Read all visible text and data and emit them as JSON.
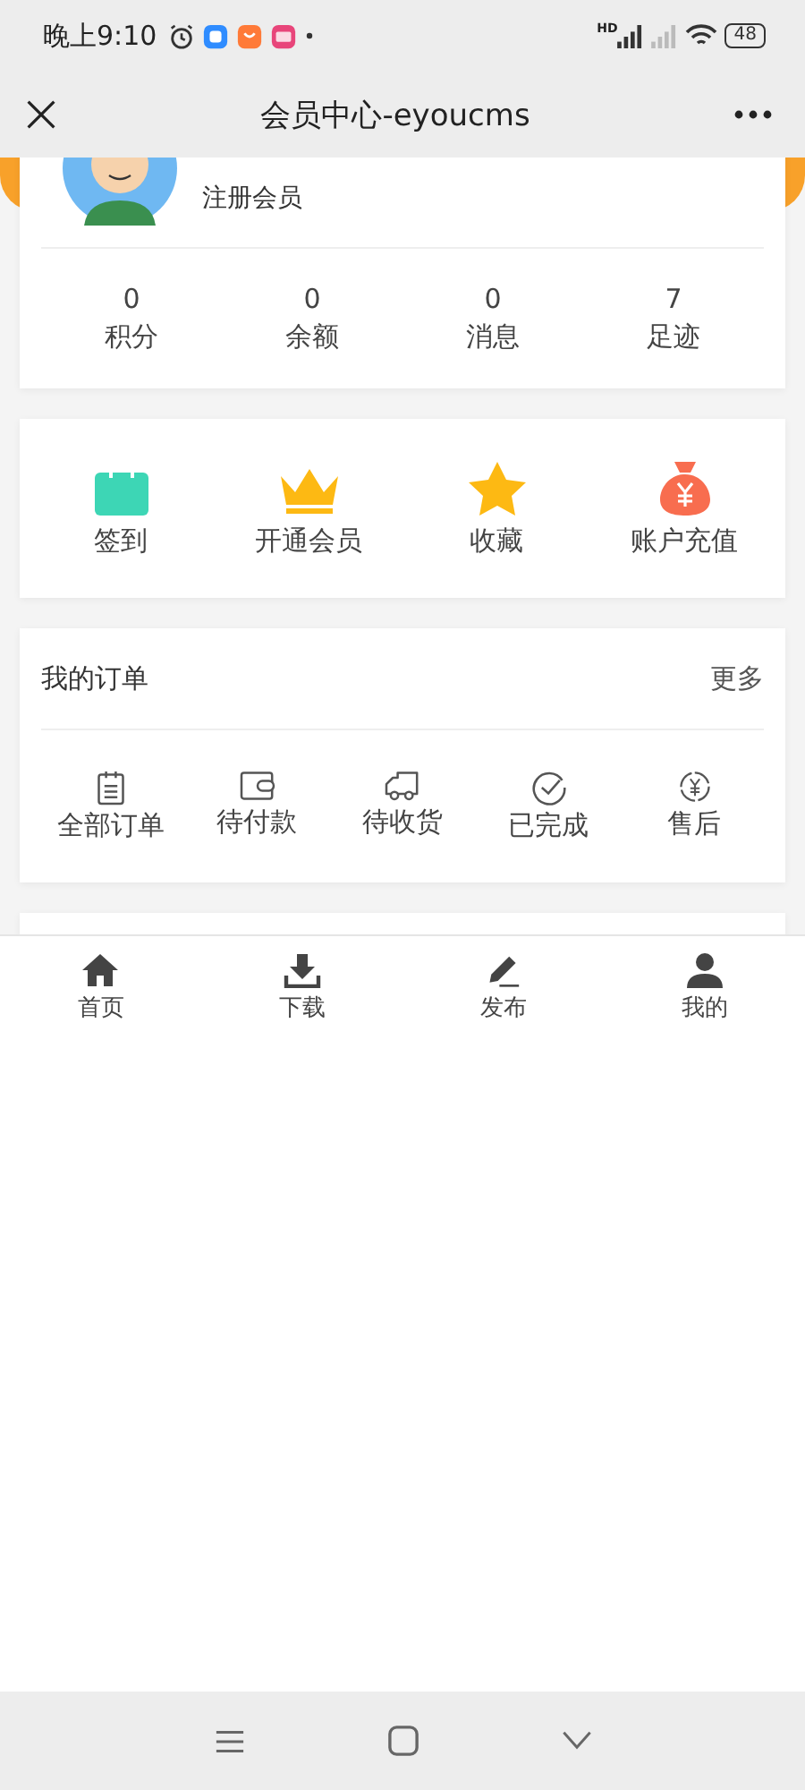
{
  "status_bar": {
    "time": "晚上9:10",
    "network_label": "HD",
    "battery": "48"
  },
  "nav": {
    "title": "会员中心-eyoucms"
  },
  "profile": {
    "level_name": "注册会员",
    "stats": [
      {
        "value": "0",
        "label": "积分"
      },
      {
        "value": "0",
        "label": "余额"
      },
      {
        "value": "0",
        "label": "消息"
      },
      {
        "value": "7",
        "label": "足迹"
      }
    ]
  },
  "shortcuts": [
    {
      "kind": "calendar",
      "label": "签到",
      "color": "#3dd6b5"
    },
    {
      "kind": "crown",
      "label": "开通会员",
      "color": "#fdb913"
    },
    {
      "kind": "star",
      "label": "收藏",
      "color": "#fdb913"
    },
    {
      "kind": "moneybag",
      "label": "账户充值",
      "color": "#f86d4f"
    }
  ],
  "orders": {
    "title": "我的订单",
    "more": "更多",
    "items": [
      {
        "kind": "clipboard",
        "label": "全部订单"
      },
      {
        "kind": "wallet",
        "label": "待付款"
      },
      {
        "kind": "truck",
        "label": "待收货"
      },
      {
        "kind": "check",
        "label": "已完成"
      },
      {
        "kind": "yen",
        "label": "售后"
      }
    ]
  },
  "tab_bar": [
    {
      "kind": "home",
      "label": "首页"
    },
    {
      "kind": "download",
      "label": "下载"
    },
    {
      "kind": "pen",
      "label": "发布"
    },
    {
      "kind": "user",
      "label": "我的"
    }
  ]
}
